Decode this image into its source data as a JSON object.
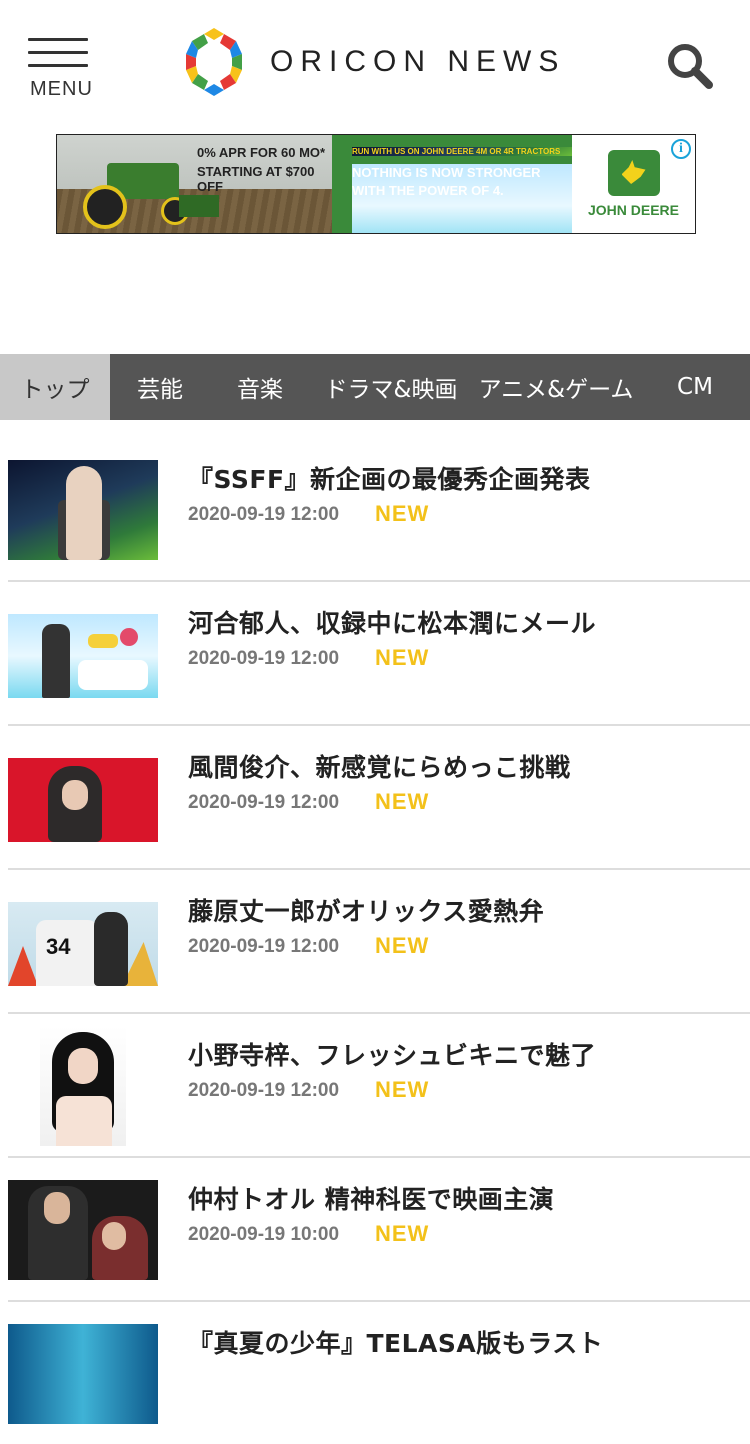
{
  "header": {
    "menu_label": "MENU",
    "logo_text": "ORICON NEWS"
  },
  "ad": {
    "offer_line1": "0% APR FOR 60 MO*",
    "offer_line2": "STARTING AT $700 OFF",
    "small_text": "RUN WITH US ON JOHN DEERE 4M OR 4R TRACTORS",
    "headline": "NOTHING IS NOW STRONGER WITH THE POWER OF 4.",
    "brand": "JOHN DEERE",
    "info_symbol": "i"
  },
  "tabs": [
    {
      "label": "トップ",
      "active": true
    },
    {
      "label": "芸能",
      "active": false
    },
    {
      "label": "音楽",
      "active": false
    },
    {
      "label": "ドラマ&映画",
      "active": false
    },
    {
      "label": "アニメ&ゲーム",
      "active": false
    },
    {
      "label": "CM",
      "active": false
    }
  ],
  "news": [
    {
      "title": "『SSFF』新企画の最優秀企画発表",
      "date": "2020-09-19 12:00",
      "badge": "NEW"
    },
    {
      "title": "河合郁人、収録中に松本潤にメール",
      "date": "2020-09-19 12:00",
      "badge": "NEW"
    },
    {
      "title": "風間俊介、新感覚にらめっこ挑戦",
      "date": "2020-09-19 12:00",
      "badge": "NEW"
    },
    {
      "title": "藤原丈一郎がオリックス愛熱弁",
      "date": "2020-09-19 12:00",
      "badge": "NEW"
    },
    {
      "title": "小野寺梓、フレッシュビキニで魅了",
      "date": "2020-09-19 12:00",
      "badge": "NEW"
    },
    {
      "title": "仲村トオル 精神科医で映画主演",
      "date": "2020-09-19 10:00",
      "badge": "NEW"
    },
    {
      "title": "『真夏の少年』TELASA版もラスト",
      "date": "",
      "badge": ""
    }
  ],
  "thumb_jersey_number": "34",
  "colors": {
    "tab_bar": "#555555",
    "tab_active": "#c8c8c8",
    "new_badge": "#f3c11a",
    "ad_green": "#3a8a3a"
  }
}
